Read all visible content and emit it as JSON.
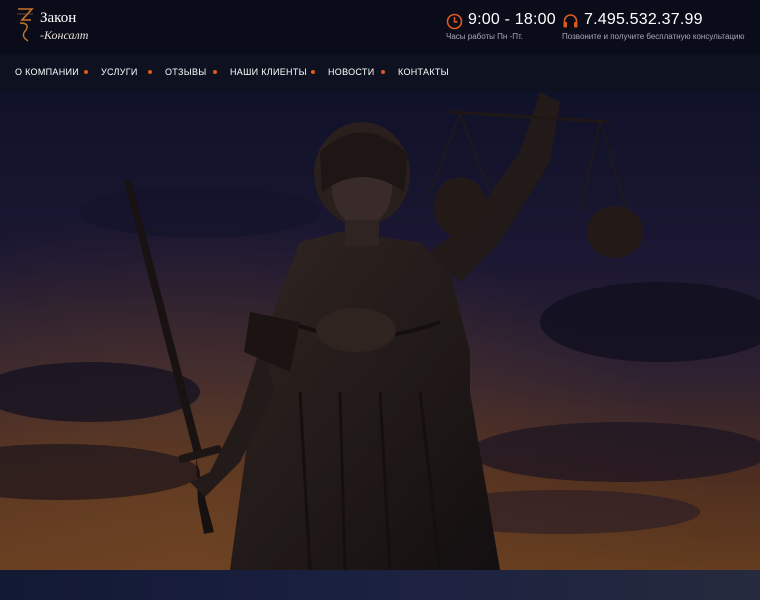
{
  "header": {
    "logo": {
      "line1": "Закон",
      "line2": "-Консалт"
    },
    "hours": {
      "icon": "clock-icon",
      "value": "9:00 - 18:00",
      "caption": "Часы работы Пн -Пт."
    },
    "phone": {
      "icon": "headset-icon",
      "value": "7.495.532.37.99",
      "caption": "Позвоните и получите бесплатную консультацию"
    }
  },
  "nav": {
    "items": [
      {
        "label": "О КОМПАНИИ"
      },
      {
        "label": "УСЛУГИ"
      },
      {
        "label": "ОТЗЫВЫ"
      },
      {
        "label": "НАШИ КЛИЕНТЫ"
      },
      {
        "label": "НОВОСТИ"
      },
      {
        "label": "КОНТАКТЫ"
      }
    ]
  },
  "hero": {
    "image": "lady-justice-statue-sunset"
  },
  "colors": {
    "accent": "#e0591c",
    "background": "#0a0c1a",
    "nav": "#0e1120"
  }
}
